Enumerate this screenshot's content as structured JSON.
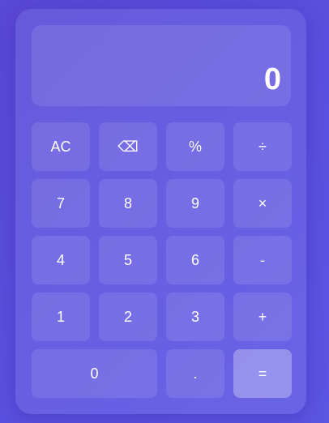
{
  "display": {
    "value": "0"
  },
  "keys": {
    "row1": {
      "clear": "AC",
      "backspace": "⌫",
      "percent": "%",
      "divide": "÷"
    },
    "row2": {
      "seven": "7",
      "eight": "8",
      "nine": "9",
      "multiply": "×"
    },
    "row3": {
      "four": "4",
      "five": "5",
      "six": "6",
      "subtract": "-"
    },
    "row4": {
      "one": "1",
      "two": "2",
      "three": "3",
      "add": "+"
    },
    "row5": {
      "zero": "0",
      "decimal": ".",
      "equals": "="
    }
  },
  "colors": {
    "background": "#5a4fe0",
    "text": "#ffffff"
  }
}
